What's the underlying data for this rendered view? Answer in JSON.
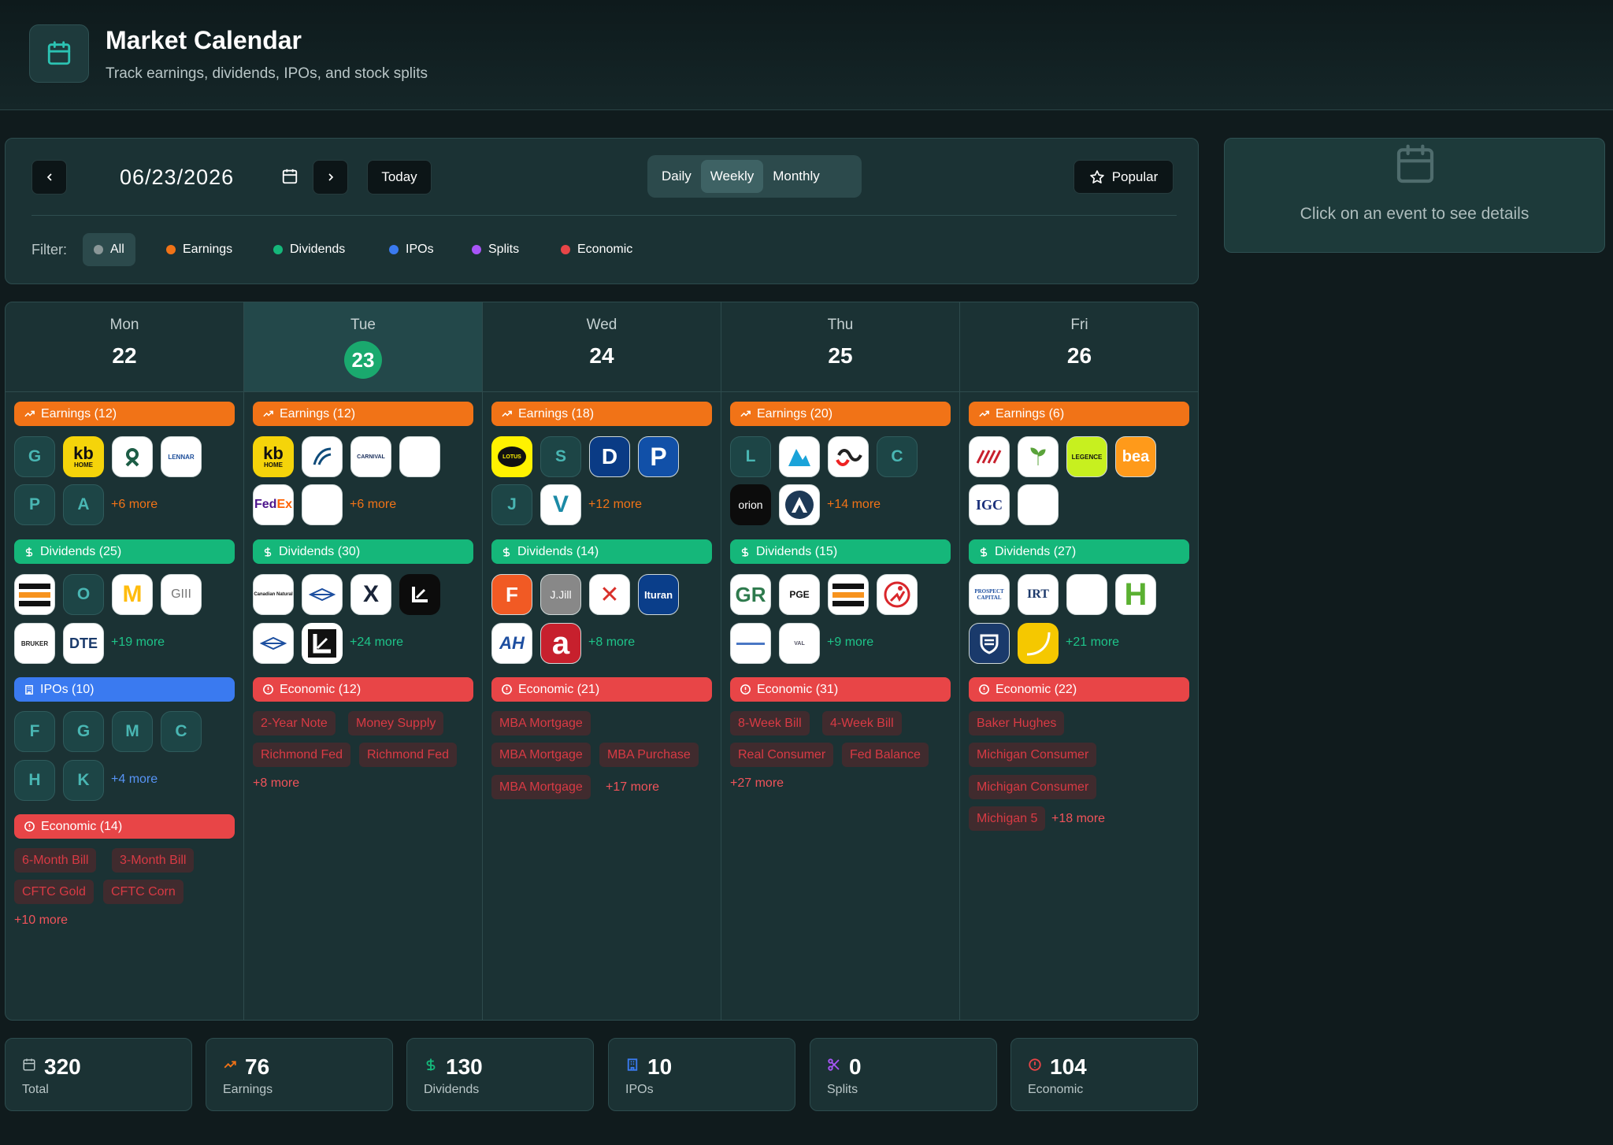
{
  "header": {
    "title": "Market Calendar",
    "subtitle": "Track earnings, dividends, IPOs, and stock splits"
  },
  "toolbar": {
    "date": "06/23/2026",
    "today_label": "Today",
    "views": [
      "Daily",
      "Weekly",
      "Monthly"
    ],
    "active_view": "Weekly",
    "popular_label": "Popular",
    "filter_label": "Filter:",
    "filters": [
      {
        "label": "All",
        "color": "#8a9798",
        "active": true
      },
      {
        "label": "Earnings",
        "color": "#f17317"
      },
      {
        "label": "Dividends",
        "color": "#15b77a"
      },
      {
        "label": "IPOs",
        "color": "#3a7af0"
      },
      {
        "label": "Splits",
        "color": "#a855f7"
      },
      {
        "label": "Economic",
        "color": "#e84547"
      }
    ]
  },
  "details": {
    "empty_text": "Click on an event to see details"
  },
  "days": [
    {
      "name": "Mon",
      "date": "22",
      "earnings": {
        "label": "Earnings (12)",
        "more": "+6 more",
        "logos": [
          "G",
          "kb HOME",
          "ring-logo",
          "LENNAR",
          "P",
          "A"
        ]
      },
      "dividends": {
        "label": "Dividends (25)",
        "more": "+19 more",
        "logos": [
          "stripes-logo",
          "O",
          "McDonald's",
          "GIII",
          "BRUKER",
          "DTE"
        ]
      },
      "ipos": {
        "label": "IPOs (10)",
        "more": "+4 more",
        "logos": [
          "F",
          "G",
          "M",
          "C",
          "H",
          "K"
        ]
      },
      "economic": {
        "label": "Economic (14)",
        "more": "+10 more",
        "items": [
          "6-Month Bill",
          "3-Month Bill",
          "CFTC Gold",
          "CFTC Corn"
        ]
      }
    },
    {
      "name": "Tue",
      "date": "23",
      "today": true,
      "earnings": {
        "label": "Earnings (12)",
        "more": "+6 more",
        "logos": [
          "kb HOME",
          "wave-logo",
          "CARNIVAL",
          "",
          "FedEx",
          ""
        ]
      },
      "dividends": {
        "label": "Dividends (30)",
        "more": "+24 more",
        "logos": [
          "Canadian Natural",
          "diamond-logo",
          "X",
          "L-logo",
          "diamond-logo",
          "L-logo"
        ]
      },
      "economic": {
        "label": "Economic (12)",
        "more": "+8 more",
        "items": [
          "2-Year Note",
          "Money Supply",
          "Richmond Fed",
          "Richmond Fed"
        ]
      }
    },
    {
      "name": "Wed",
      "date": "24",
      "earnings": {
        "label": "Earnings (18)",
        "more": "+12 more",
        "logos": [
          "LOTUS",
          "S",
          "D",
          "P",
          "J",
          "V"
        ]
      },
      "dividends": {
        "label": "Dividends (14)",
        "more": "+8 more",
        "logos": [
          "F-logo",
          "J.Jill",
          "X-logo",
          "Ituran",
          "AH",
          "a"
        ]
      },
      "economic": {
        "label": "Economic (21)",
        "more": "+17 more",
        "items": [
          "MBA Mortgage",
          "MBA Mortgage",
          "MBA Purchase",
          "MBA Mortgage"
        ]
      }
    },
    {
      "name": "Thu",
      "date": "25",
      "earnings": {
        "label": "Earnings (20)",
        "more": "+14 more",
        "logos": [
          "L",
          "triangle-logo",
          "S-logo",
          "C",
          "orion",
          "A-logo"
        ]
      },
      "dividends": {
        "label": "Dividends (15)",
        "more": "+9 more",
        "logos": [
          "GR",
          "PGE",
          "stripes-logo",
          "runner-logo",
          "",
          ""
        ]
      },
      "economic": {
        "label": "Economic (31)",
        "more": "+27 more",
        "items": [
          "8-Week Bill",
          "4-Week Bill",
          "Real Consumer",
          "Fed Balance"
        ]
      }
    },
    {
      "name": "Fri",
      "date": "26",
      "earnings": {
        "label": "Earnings (6)",
        "more": "",
        "logos": [
          "stripes-red",
          "GreenPower",
          "LEGENCE",
          "bea",
          "IGC",
          ""
        ]
      },
      "dividends": {
        "label": "Dividends (27)",
        "more": "+21 more",
        "logos": [
          "PROSPECT CAPITAL",
          "IRT",
          "",
          "H",
          "shield-logo",
          "yellow-logo"
        ]
      },
      "economic": {
        "label": "Economic (22)",
        "more": "+18 more",
        "items": [
          "Baker Hughes",
          "Michigan Consumer",
          "Michigan Consumer",
          "Michigan 5"
        ]
      }
    }
  ],
  "stats": [
    {
      "value": "320",
      "label": "Total",
      "icon": "calendar-icon",
      "color": "#b9c6c7"
    },
    {
      "value": "76",
      "label": "Earnings",
      "icon": "trend-icon",
      "color": "#f17317"
    },
    {
      "value": "130",
      "label": "Dividends",
      "icon": "dollar-icon",
      "color": "#15b77a"
    },
    {
      "value": "10",
      "label": "IPOs",
      "icon": "building-icon",
      "color": "#3a7af0"
    },
    {
      "value": "0",
      "label": "Splits",
      "icon": "scissors-icon",
      "color": "#a855f7"
    },
    {
      "value": "104",
      "label": "Economic",
      "icon": "alert-icon",
      "color": "#e84547"
    }
  ]
}
